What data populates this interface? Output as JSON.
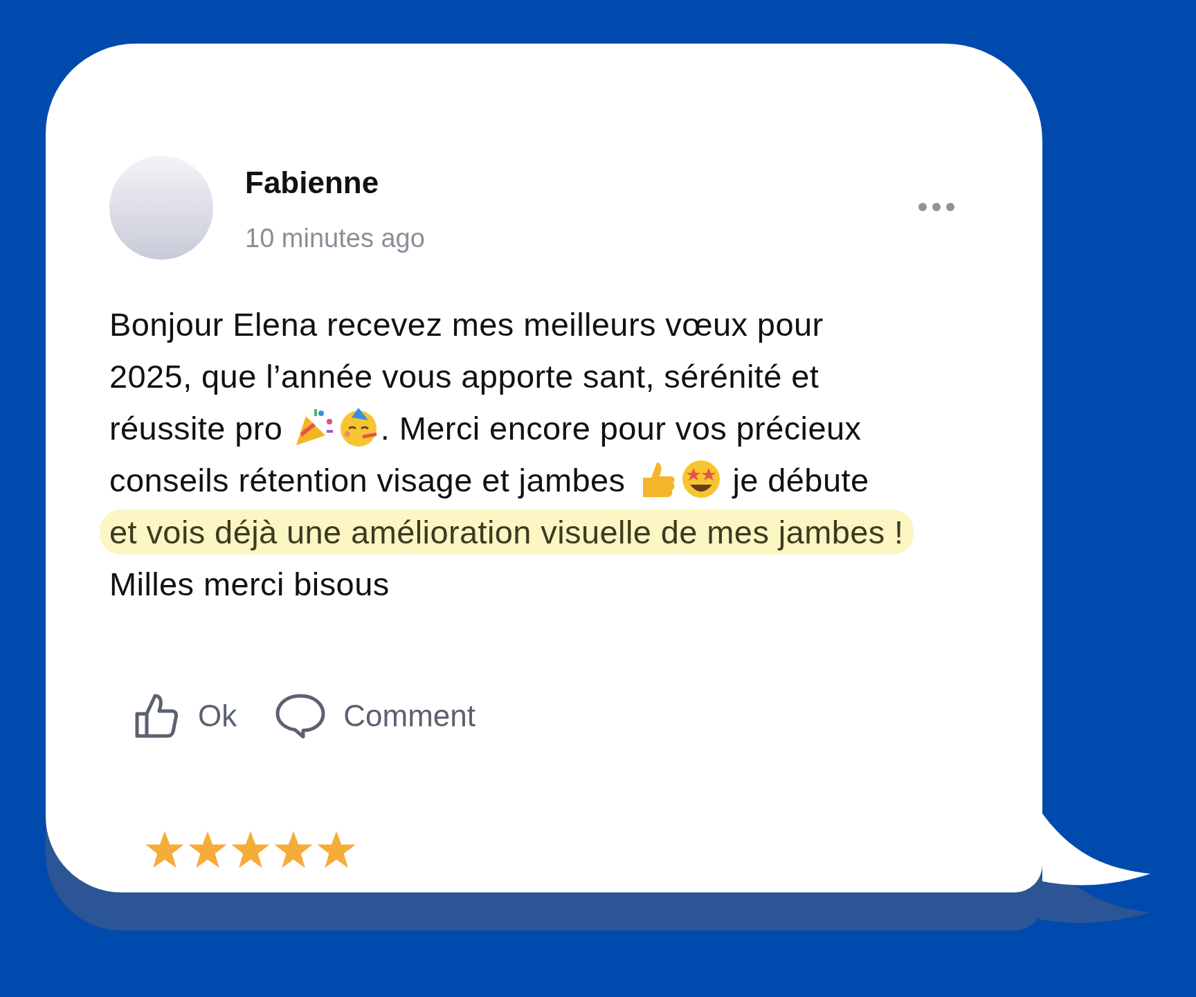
{
  "post": {
    "author": "Fabienne",
    "time": "10 minutes ago",
    "body_lines": [
      [
        {
          "kind": "text",
          "text": "Bonjour Elena recevez mes meilleurs vœux pour",
          "highlighted": false
        }
      ],
      [
        {
          "kind": "text",
          "text": "2025, que l’année vous apporte sant, sérénité et",
          "highlighted": false
        }
      ],
      [
        {
          "kind": "text",
          "text": "réussite pro ",
          "highlighted": false
        },
        {
          "kind": "party-popper"
        },
        {
          "kind": "partying-face"
        },
        {
          "kind": "text",
          "text": ". Merci encore pour vos précieux",
          "highlighted": false
        }
      ],
      [
        {
          "kind": "text",
          "text": "conseils rétention visage et jambes ",
          "highlighted": false
        },
        {
          "kind": "thumbs-up"
        },
        {
          "kind": "star-struck"
        },
        {
          "kind": "text",
          "text": " je débute",
          "highlighted": false
        }
      ],
      [
        {
          "kind": "text",
          "text": "et vois déjà une amélioration visuelle de mes jambes !",
          "highlighted": true
        }
      ],
      [
        {
          "kind": "text",
          "text": "Milles merci bisous",
          "highlighted": false
        }
      ]
    ],
    "actions": [
      {
        "kind": "like",
        "label": "Ok"
      },
      {
        "kind": "comment",
        "label": "Comment"
      }
    ]
  },
  "rating": {
    "stars": 5
  }
}
